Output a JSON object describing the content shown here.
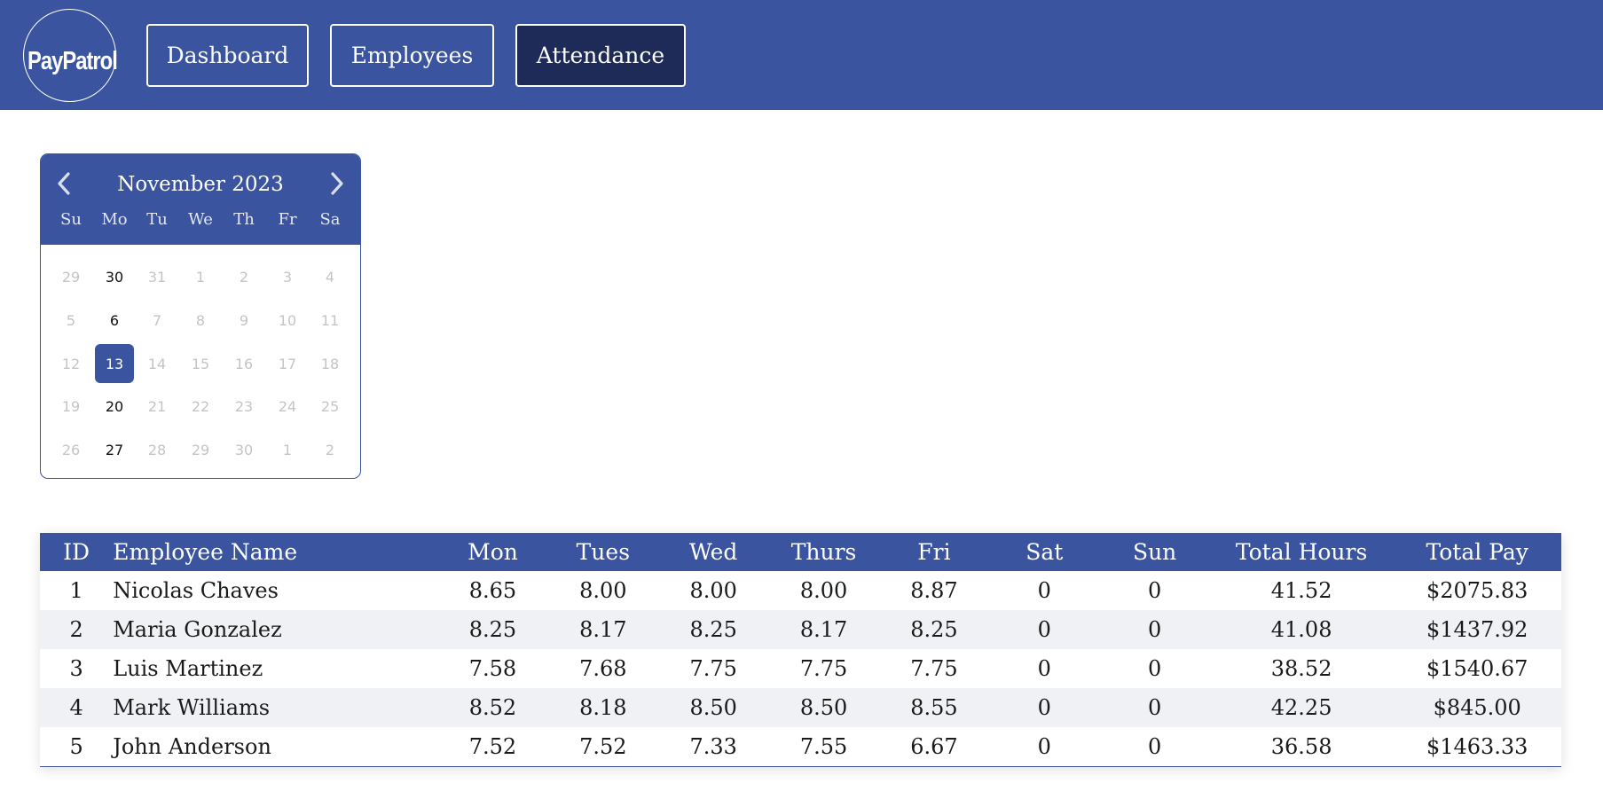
{
  "app": {
    "logo_text": "PayPatrol"
  },
  "nav": {
    "dashboard": "Dashboard",
    "employees": "Employees",
    "attendance": "Attendance",
    "active": "attendance"
  },
  "calendar": {
    "month_label": "November 2023",
    "prev_icon": "chevron-left-icon",
    "next_icon": "chevron-right-icon",
    "weekdays": [
      "Su",
      "Mo",
      "Tu",
      "We",
      "Th",
      "Fr",
      "Sa"
    ],
    "weeks": [
      [
        "29",
        "30",
        "31",
        "1",
        "2",
        "3",
        "4"
      ],
      [
        "5",
        "6",
        "7",
        "8",
        "9",
        "10",
        "11"
      ],
      [
        "12",
        "13",
        "14",
        "15",
        "16",
        "17",
        "18"
      ],
      [
        "19",
        "20",
        "21",
        "22",
        "23",
        "24",
        "25"
      ],
      [
        "26",
        "27",
        "28",
        "29",
        "30",
        "1",
        "2"
      ]
    ],
    "selected_day": "13"
  },
  "table": {
    "headers": [
      "ID",
      "Employee Name",
      "Mon",
      "Tues",
      "Wed",
      "Thurs",
      "Fri",
      "Sat",
      "Sun",
      "Total Hours",
      "Total Pay"
    ],
    "rows": [
      [
        "1",
        "Nicolas Chaves",
        "8.65",
        "8.00",
        "8.00",
        "8.00",
        "8.87",
        "0",
        "0",
        "41.52",
        "$2075.83"
      ],
      [
        "2",
        "Maria Gonzalez",
        "8.25",
        "8.17",
        "8.25",
        "8.17",
        "8.25",
        "0",
        "0",
        "41.08",
        "$1437.92"
      ],
      [
        "3",
        "Luis Martinez",
        "7.58",
        "7.68",
        "7.75",
        "7.75",
        "7.75",
        "0",
        "0",
        "38.52",
        "$1540.67"
      ],
      [
        "4",
        "Mark Williams",
        "8.52",
        "8.18",
        "8.50",
        "8.50",
        "8.55",
        "0",
        "0",
        "42.25",
        "$845.00"
      ],
      [
        "5",
        "John Anderson",
        "7.52",
        "7.52",
        "7.33",
        "7.55",
        "6.67",
        "0",
        "0",
        "36.58",
        "$1463.33"
      ]
    ]
  },
  "colors": {
    "primary": "#3a54a0",
    "active_nav": "#1e2a58",
    "row_alt": "#eff1f4",
    "disabled_day": "#c4c4c4"
  }
}
